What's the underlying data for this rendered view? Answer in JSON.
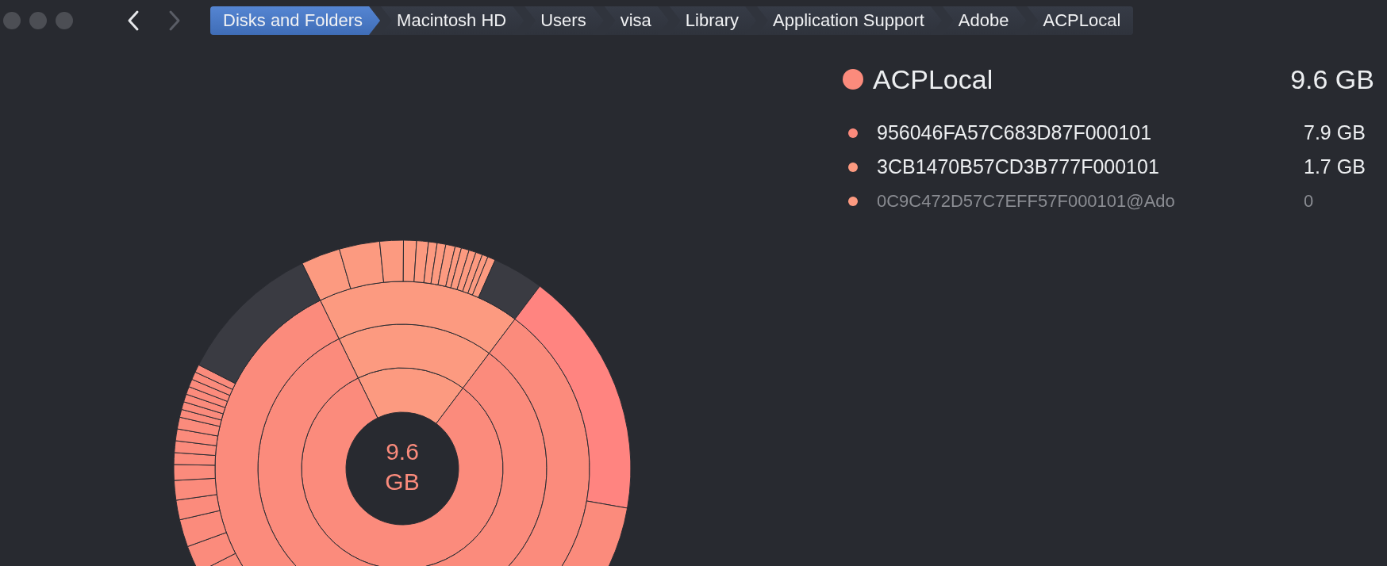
{
  "navigation": {
    "back": {
      "disabled": false
    },
    "forward": {
      "disabled": true
    }
  },
  "breadcrumbs": [
    {
      "label": "Disks and Folders",
      "selected": true
    },
    {
      "label": "Macintosh HD",
      "selected": false
    },
    {
      "label": "Users",
      "selected": false
    },
    {
      "label": "visa",
      "selected": false
    },
    {
      "label": "Library",
      "selected": false
    },
    {
      "label": "Application Support",
      "selected": false
    },
    {
      "label": "Adobe",
      "selected": false
    },
    {
      "label": "ACPLocal",
      "selected": false
    }
  ],
  "chart": {
    "center_label": "9.6 GB"
  },
  "summary": {
    "name": "ACPLocal",
    "size": "9.6 GB",
    "color": "#fb8b7c"
  },
  "items": [
    {
      "name": "956046FA57C683D87F000101",
      "size": "7.9 GB",
      "color": "#fb8a7c",
      "dimmed": false
    },
    {
      "name": "3CB1470B57CD3B777F000101",
      "size": "1.7 GB",
      "color": "#fc9a80",
      "dimmed": false
    },
    {
      "name": "0C9C472D57C7EFF57F000101@Ado",
      "size": "0",
      "color": "#fc9a80",
      "dimmed": true
    }
  ]
}
